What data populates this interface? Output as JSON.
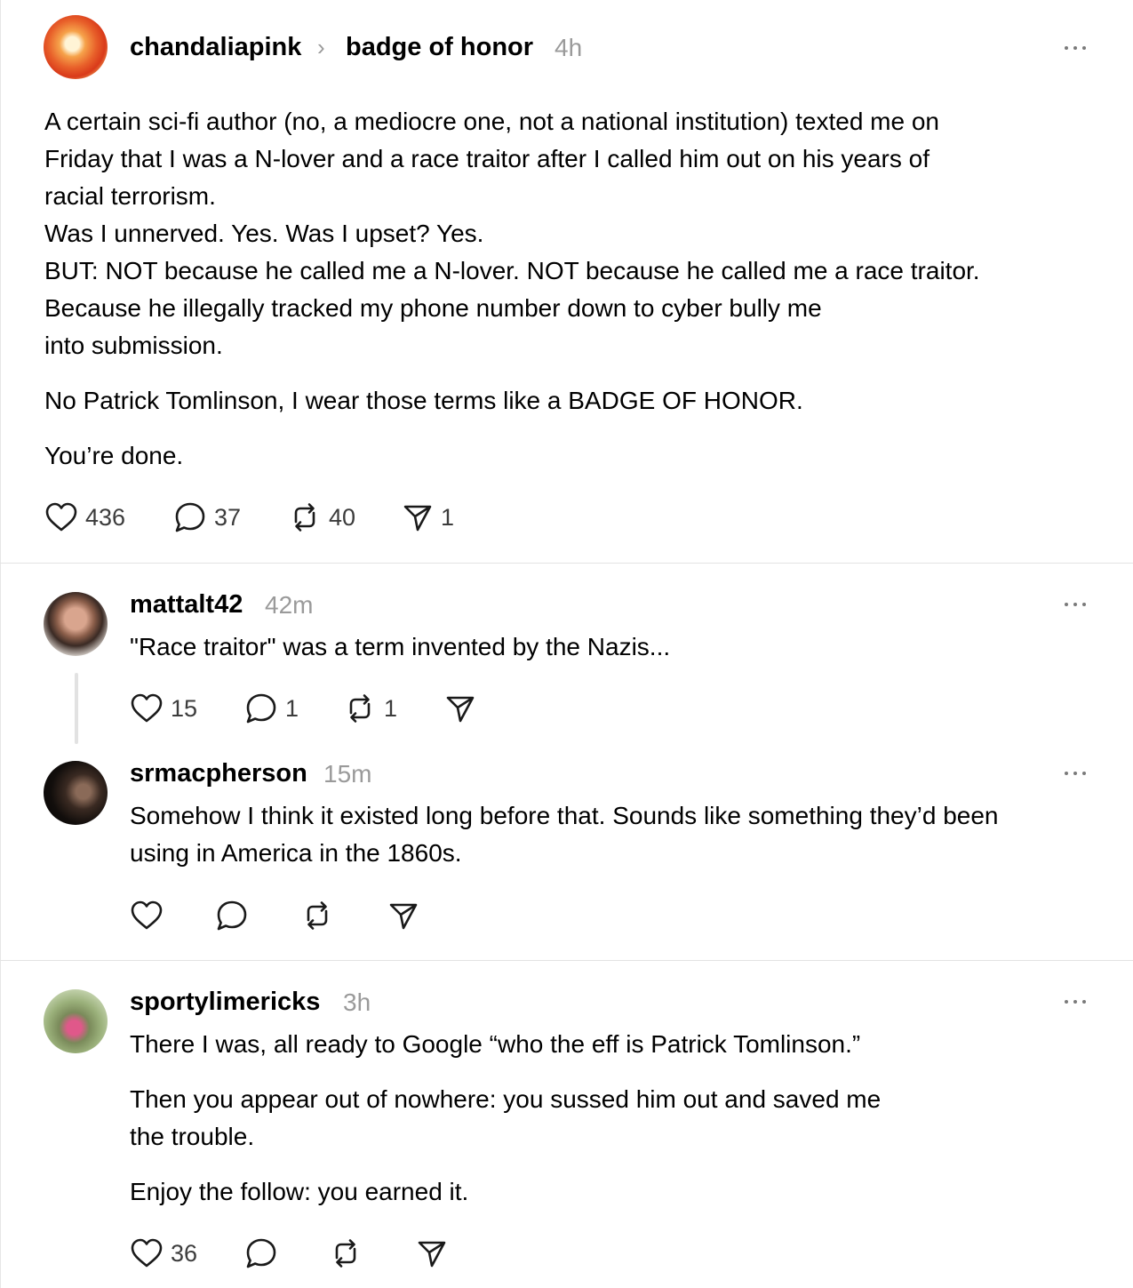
{
  "post": {
    "username": "chandaliapink",
    "topic": "badge of honor",
    "time": "4h",
    "lines": [
      "A certain sci-fi author (no, a mediocre one, not a national institution) texted me on",
      "Friday that I was a N-lover and a race traitor after I called him out on his years of",
      "racial terrorism.",
      "Was I unnerved. Yes. Was I upset? Yes.",
      "BUT: NOT because he called me a N-lover. NOT because he called me a race traitor.",
      "Because he illegally tracked my phone number down to cyber bully me",
      "into submission."
    ],
    "para2": "No Patrick Tomlinson, I wear those terms like a BADGE OF HONOR.",
    "para3": "You’re done.",
    "likes": "436",
    "replies": "37",
    "reposts": "40",
    "shares": "1"
  },
  "reply1": {
    "username": "mattalt42",
    "time": "42m",
    "text": "\"Race traitor\" was a term invented by the Nazis...",
    "likes": "15",
    "replies": "1",
    "reposts": "1"
  },
  "reply2": {
    "username": "srmacpherson",
    "time": "15m",
    "lines": [
      "Somehow I think it existed long before that. Sounds like something they’d been",
      "using in America in the 1860s."
    ]
  },
  "reply3": {
    "username": "sportylimericks",
    "time": "3h",
    "para1": "There I was, all ready to Google “who the eff is Patrick Tomlinson.”",
    "para2_lines": [
      "Then you appear out of nowhere: you sussed him out and saved me",
      "the trouble."
    ],
    "para3": "Enjoy the follow: you earned it.",
    "likes": "36"
  },
  "icons": [
    "heart-icon",
    "comment-icon",
    "repost-icon",
    "share-icon",
    "more-icon",
    "chevron-right-icon"
  ]
}
